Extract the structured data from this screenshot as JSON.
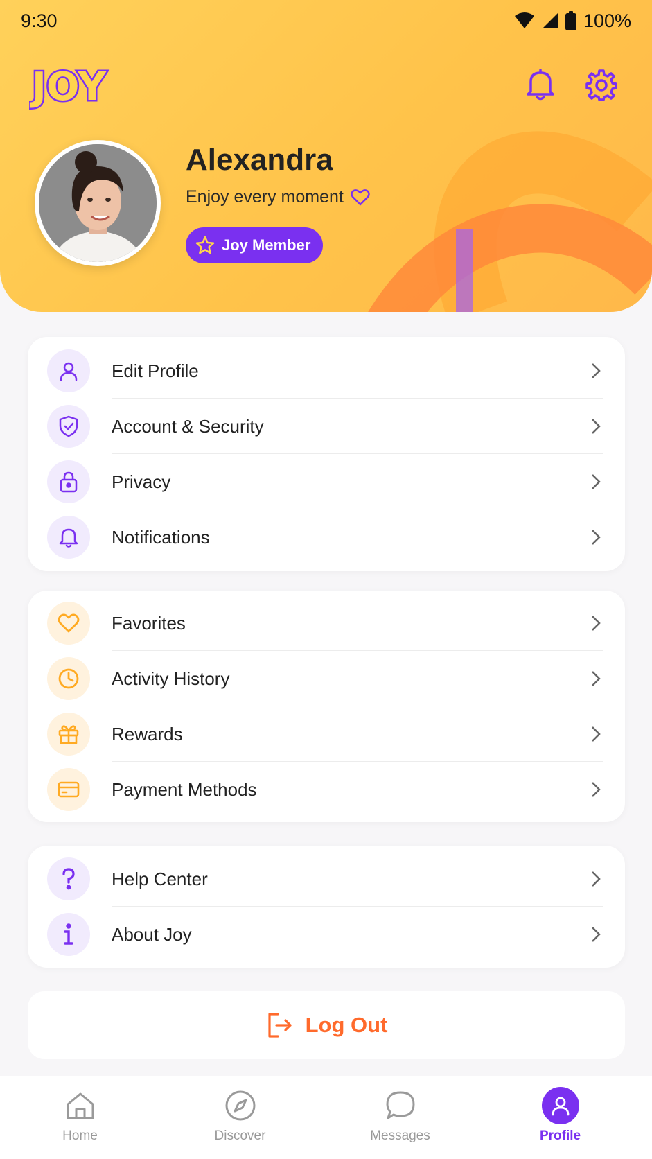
{
  "status_bar": {
    "time": "9:30",
    "battery": "100%"
  },
  "header": {
    "logo_text": "JOY",
    "bell_icon": "bell-icon",
    "settings_icon": "gear-icon",
    "profile": {
      "name": "Alexandra",
      "tagline": "Enjoy every moment",
      "badge": "Joy Member"
    }
  },
  "menu_group_1": [
    {
      "label": "Edit Profile",
      "icon": "user-icon"
    },
    {
      "label": "Account & Security",
      "icon": "shield-icon"
    },
    {
      "label": "Privacy",
      "icon": "lock-icon"
    },
    {
      "label": "Notifications",
      "icon": "bell-icon"
    }
  ],
  "menu_group_2": [
    {
      "label": "Favorites",
      "icon": "heart-icon"
    },
    {
      "label": "Activity History",
      "icon": "clock-icon"
    },
    {
      "label": "Rewards",
      "icon": "gift-icon"
    },
    {
      "label": "Payment Methods",
      "icon": "card-icon"
    }
  ],
  "menu_group_3": [
    {
      "label": "Help Center",
      "icon": "question-icon"
    },
    {
      "label": "About Joy",
      "icon": "info-icon"
    }
  ],
  "logout_label": "Log Out",
  "bottom_nav": [
    {
      "label": "Home",
      "icon": "home-icon"
    },
    {
      "label": "Discover",
      "icon": "compass-icon"
    },
    {
      "label": "Messages",
      "icon": "chat-icon"
    },
    {
      "label": "Profile",
      "icon": "profile-icon",
      "active": true
    }
  ],
  "colors": {
    "accent_purple": "#7a30f0",
    "accent_orange": "#ff6a2c",
    "header_yellow": "#ffc84f"
  }
}
